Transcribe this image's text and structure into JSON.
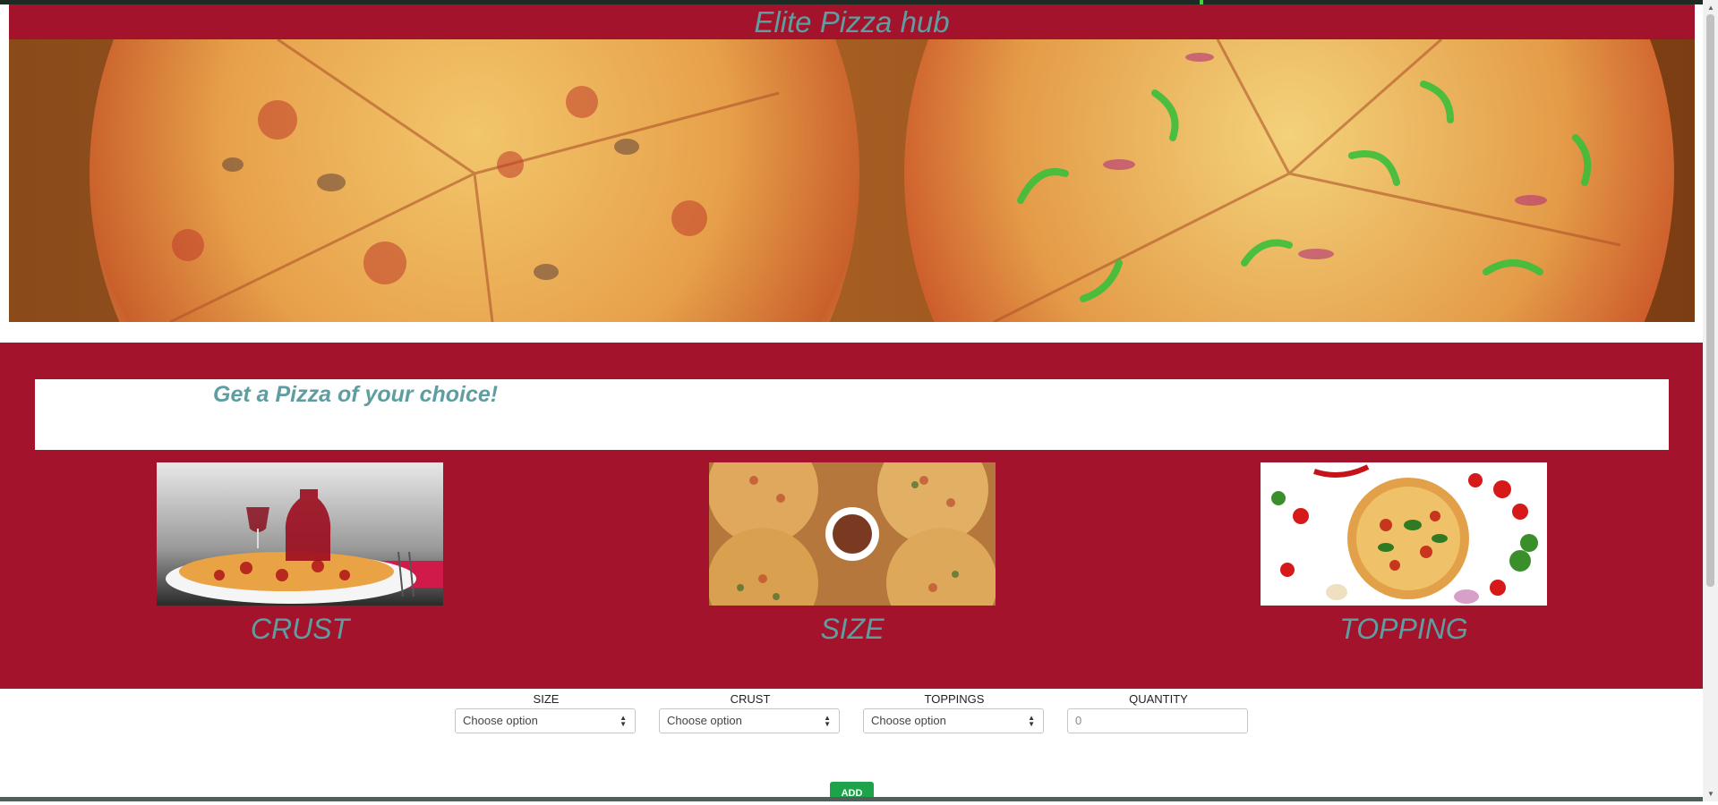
{
  "header": {
    "title": "Elite Pizza hub"
  },
  "hero": {
    "image": "two-pizzas-banner"
  },
  "promo": {
    "headline": "Get a Pizza of your choice!"
  },
  "cards": [
    {
      "caption": "CRUST",
      "image": "pizza-with-wine"
    },
    {
      "caption": "SIZE",
      "image": "four-pizzas-top-view"
    },
    {
      "caption": "TOPPING",
      "image": "pizza-with-vegetables"
    }
  ],
  "form": {
    "size": {
      "label": "SIZE",
      "value": "Choose option"
    },
    "crust": {
      "label": "CRUST",
      "value": "Choose option"
    },
    "toppings": {
      "label": "TOPPINGS",
      "value": "Choose option"
    },
    "quantity": {
      "label": "QUANTITY",
      "value": "0"
    }
  },
  "actions": {
    "add_label": "ADD"
  },
  "colors": {
    "brand_red": "#a3132c",
    "title_teal": "#5f9ea0",
    "button_green": "#1ea24a"
  }
}
